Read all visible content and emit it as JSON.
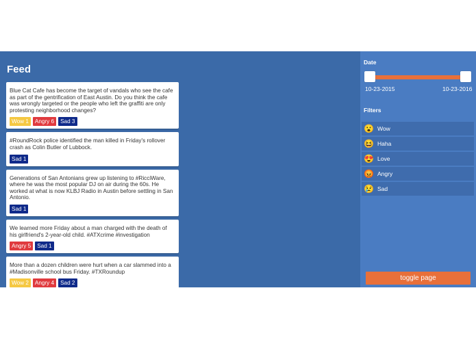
{
  "feed": {
    "title": "Feed",
    "posts": [
      {
        "text": "Blue Cat Cafe has become the target of vandals who see the cafe as part of the gentrification of East Austin. Do you think the cafe was wrongly targeted or the people who left the graffiti are only protesting neighborhood changes?",
        "tags": [
          {
            "type": "wow",
            "label": "Wow 1"
          },
          {
            "type": "angry",
            "label": "Angry 6"
          },
          {
            "type": "sad",
            "label": "Sad 3"
          }
        ]
      },
      {
        "text": "#RoundRock police identified the man killed in Friday's rollover crash as Colin Butler of Lubbock.",
        "tags": [
          {
            "type": "sad",
            "label": "Sad 1"
          }
        ]
      },
      {
        "text": "Generations of San Antonians grew up listening to #RicciWare, where he was the most popular DJ on air during the 60s. He worked at what is now KLBJ Radio in Austin before settling in San Antonio.",
        "tags": [
          {
            "type": "sad",
            "label": "Sad 1"
          }
        ]
      },
      {
        "text": "We learned more Friday about a man charged with the death of his girlfriend's 2-year-old child. #ATXcrime #investigation",
        "tags": [
          {
            "type": "angry",
            "label": "Angry 5"
          },
          {
            "type": "sad",
            "label": "Sad 1"
          }
        ]
      },
      {
        "text": "More than a dozen children were hurt when a car slammed into a #Madisonville school bus Friday. #TXRoundup",
        "tags": [
          {
            "type": "wow",
            "label": "Wow 2"
          },
          {
            "type": "angry",
            "label": "Angry 4"
          },
          {
            "type": "sad",
            "label": "Sad 2"
          }
        ]
      }
    ]
  },
  "sidebar": {
    "date_label": "Date",
    "date_start": "10-23-2015",
    "date_end": "10-23-2016",
    "filters_label": "Filters",
    "filters": [
      {
        "label": "Wow",
        "icon": "wow-emoji-icon",
        "glyph": "😮"
      },
      {
        "label": "Haha",
        "icon": "haha-emoji-icon",
        "glyph": "😆"
      },
      {
        "label": "Love",
        "icon": "love-emoji-icon",
        "glyph": "😍"
      },
      {
        "label": "Angry",
        "icon": "angry-emoji-icon",
        "glyph": "😡"
      },
      {
        "label": "Sad",
        "icon": "sad-emoji-icon",
        "glyph": "😢"
      }
    ],
    "toggle_label": "toggle page"
  },
  "colors": {
    "background": "#3b6aa8",
    "sidebar": "#4a7cc2",
    "accent": "#e8703a",
    "wow": "#f5c842",
    "angry": "#e03a3e",
    "sad": "#0f2a8a"
  }
}
